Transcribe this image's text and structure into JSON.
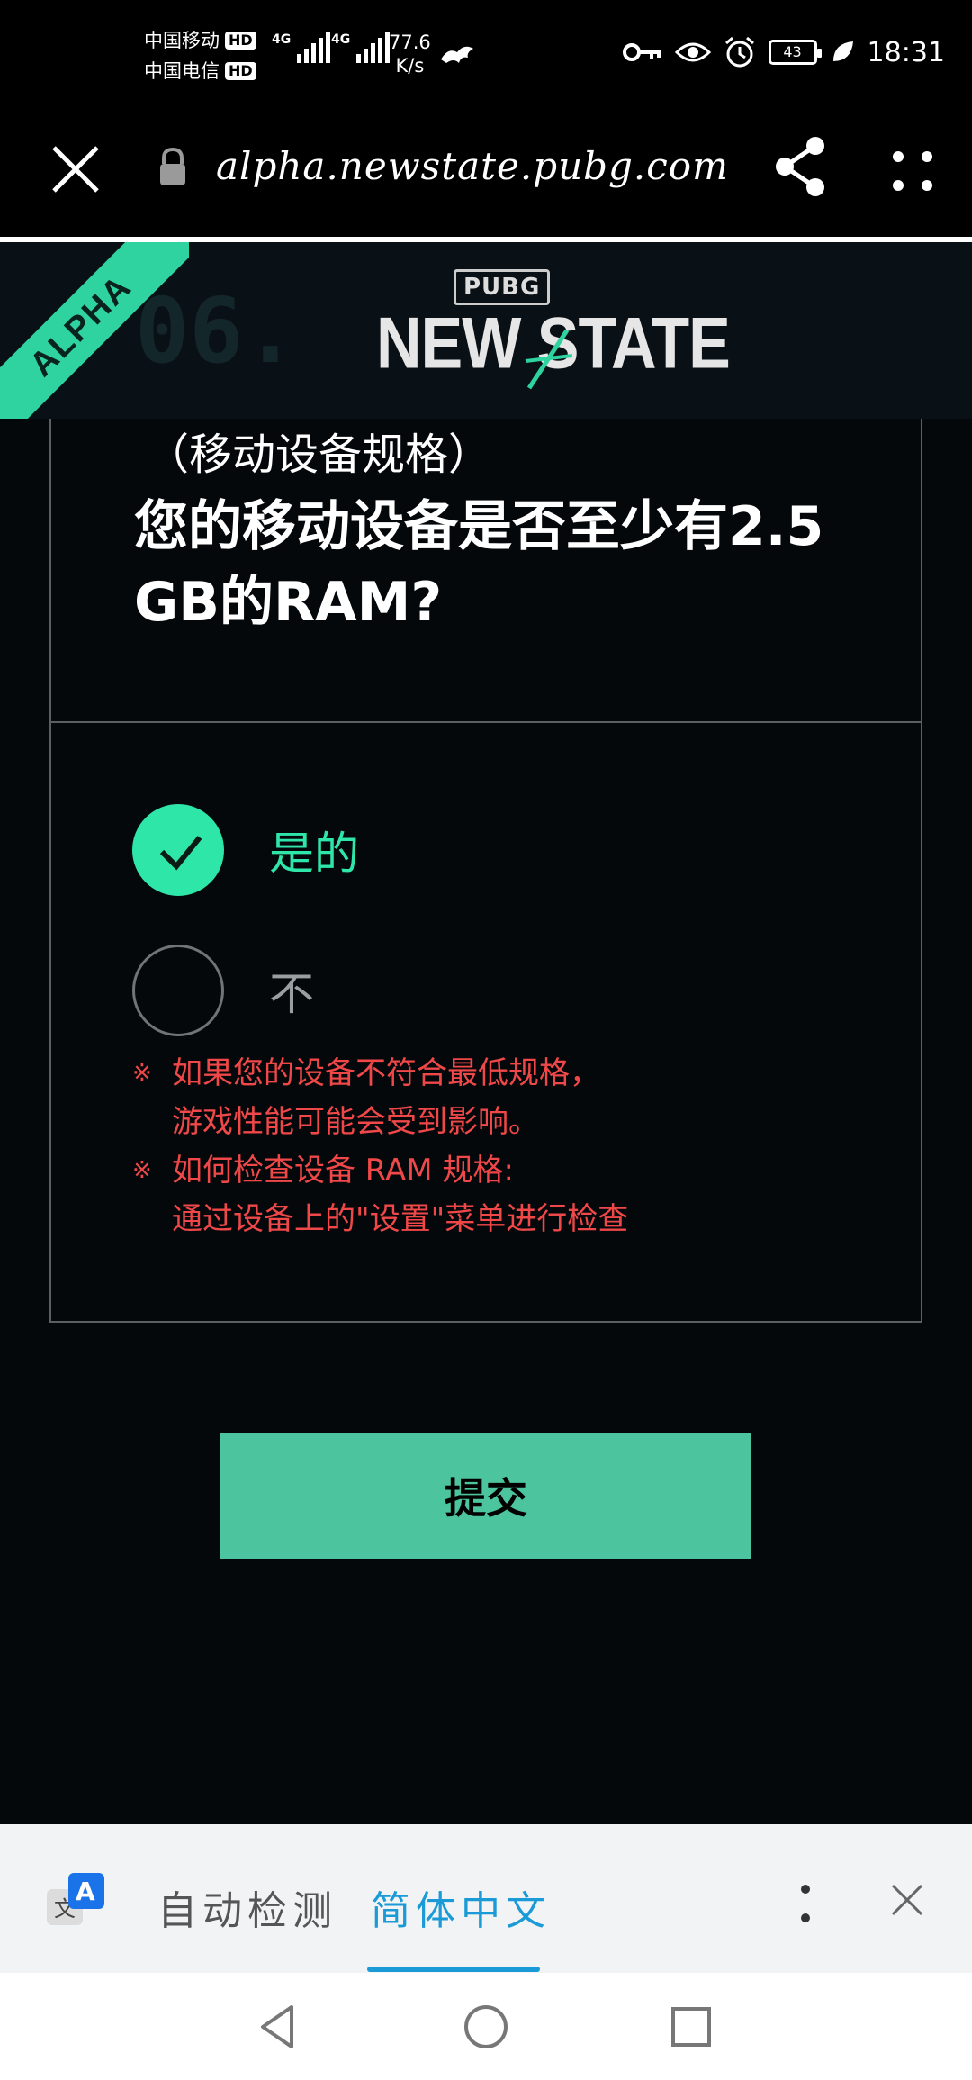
{
  "status_bar": {
    "carrier1": "中国移动",
    "carrier2": "中国电信",
    "hd_label": "HD",
    "network1": "4G",
    "network2": "4G",
    "speed_value": "77.6",
    "speed_unit": "K/s",
    "battery": "43",
    "time": "18:31",
    "icons": [
      "key-icon",
      "eye-icon",
      "alarm-icon",
      "battery-icon",
      "leaf-icon"
    ]
  },
  "browser": {
    "url": "alpha.newstate.pubg.com",
    "icons": [
      "close-icon",
      "lock-icon",
      "share-icon",
      "more-icon"
    ]
  },
  "site_header": {
    "ghost_number": "06.",
    "pubg_badge": "PUBG",
    "logo_text": "NEW STATE",
    "ribbon": "ALPHA",
    "accent_color": "#2ed3a0"
  },
  "question_card": {
    "subtitle": "（移动设备规格）",
    "question": "您的移动设备是否至少有2.5 GB的RAM?",
    "options": [
      {
        "label": "是的",
        "selected": true
      },
      {
        "label": "不",
        "selected": false
      }
    ],
    "notes": [
      {
        "mark": "※",
        "line1": "如果您的设备不符合最低规格，",
        "line2": "游戏性能可能会受到影响。"
      },
      {
        "mark": "※",
        "line1": "如何检查设备 RAM 规格:",
        "line2": "通过设备上的\"设置\"菜单进行检查"
      }
    ],
    "note_color": "#f04848",
    "selected_color": "#2ee6a8"
  },
  "submit": {
    "label": "提交",
    "color": "#4cc59e"
  },
  "translate_bar": {
    "source_lang": "自动检测",
    "target_lang": "简体中文",
    "icons": [
      "translate-icon",
      "more-vertical-icon",
      "close-icon"
    ]
  },
  "nav_bar": {
    "icons": [
      "back-icon",
      "home-icon",
      "recents-icon"
    ]
  }
}
